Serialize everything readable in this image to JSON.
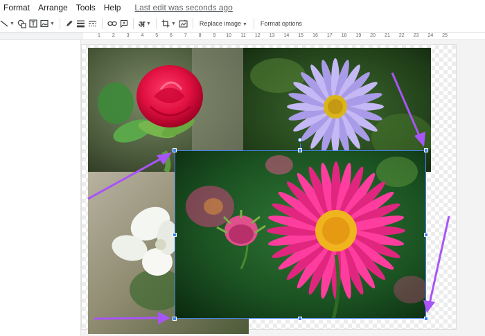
{
  "menu": {
    "items": [
      "Format",
      "Arrange",
      "Tools",
      "Help"
    ],
    "last_edit": "Last edit was seconds ago"
  },
  "toolbar": {
    "replace_image": "Replace image",
    "format_options": "Format options",
    "text_style": "अ"
  },
  "ruler": {
    "numbers": [
      "1",
      "2",
      "3",
      "4",
      "5",
      "6",
      "7",
      "8",
      "9",
      "10",
      "11",
      "12",
      "13",
      "14",
      "15",
      "16",
      "17",
      "18",
      "19",
      "20",
      "21",
      "22",
      "23",
      "24",
      "25"
    ]
  },
  "colors": {
    "selection": "#4285f4",
    "annotation_arrow": "#a855f7"
  },
  "icons": {
    "line": "line-tool-icon",
    "shape": "shape-icon",
    "textbox": "textbox-icon",
    "image": "image-icon",
    "pen": "pen-icon",
    "border_weight": "border-weight-icon",
    "border_dash": "border-dash-icon",
    "link": "link-icon",
    "comment": "comment-icon",
    "crop": "crop-icon",
    "reset_image": "reset-image-icon"
  }
}
